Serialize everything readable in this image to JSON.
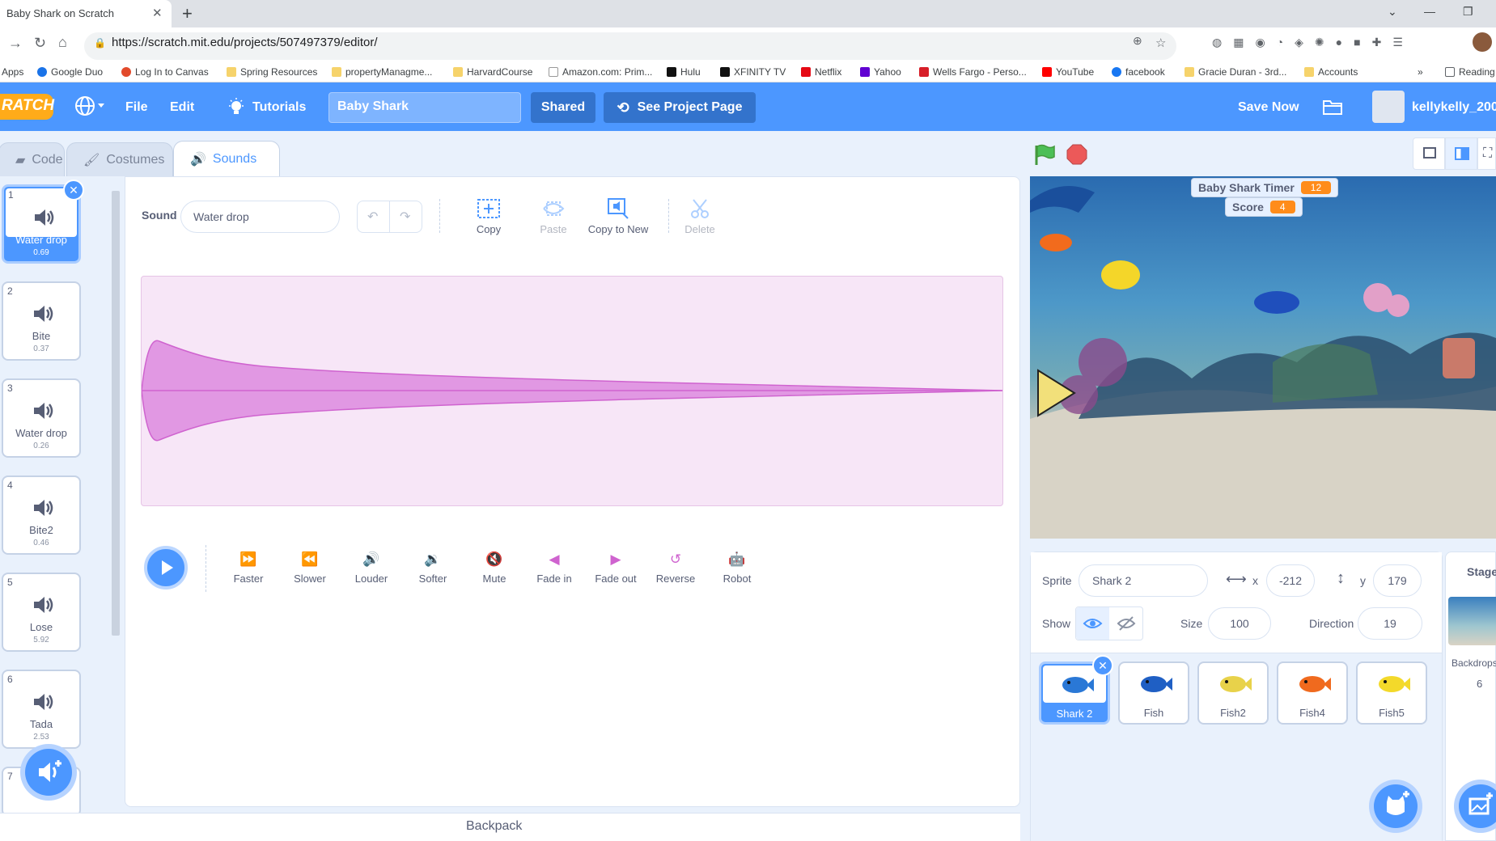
{
  "browser": {
    "tab_title": "Baby Shark on Scratch",
    "url": "https://scratch.mit.edu/projects/507497379/editor/",
    "bookmarks": [
      "Apps",
      "Google Duo",
      "Log In to Canvas",
      "Spring Resources",
      "propertyManagme...",
      "HarvardCourse",
      "Amazon.com: Prim...",
      "Hulu",
      "XFINITY TV",
      "Netflix",
      "Yahoo",
      "Wells Fargo - Perso...",
      "YouTube",
      "facebook",
      "Gracie Duran - 3rd...",
      "Accounts",
      "Reading"
    ]
  },
  "menubar": {
    "file": "File",
    "edit": "Edit",
    "tutorials": "Tutorials",
    "project_title": "Baby Shark",
    "shared": "Shared",
    "see_project": "See Project Page",
    "save_now": "Save Now",
    "username": "kellykelly_2003"
  },
  "tabs": {
    "code": "Code",
    "costumes": "Costumes",
    "sounds": "Sounds"
  },
  "sounds": [
    {
      "num": "1",
      "name": "Water drop",
      "duration": "0.69"
    },
    {
      "num": "2",
      "name": "Bite",
      "duration": "0.37"
    },
    {
      "num": "3",
      "name": "Water drop",
      "duration": "0.26"
    },
    {
      "num": "4",
      "name": "Bite2",
      "duration": "0.46"
    },
    {
      "num": "5",
      "name": "Lose",
      "duration": "5.92"
    },
    {
      "num": "6",
      "name": "Tada",
      "duration": "2.53"
    },
    {
      "num": "7",
      "name": "",
      "duration": ""
    }
  ],
  "sound_editor": {
    "label": "Sound",
    "name": "Water drop",
    "tools": {
      "copy": "Copy",
      "paste": "Paste",
      "copy_to_new": "Copy to New",
      "delete": "Delete"
    },
    "effects": [
      "Faster",
      "Slower",
      "Louder",
      "Softer",
      "Mute",
      "Fade in",
      "Fade out",
      "Reverse",
      "Robot"
    ],
    "wave_color": "#cf63cf"
  },
  "backpack": "Backpack",
  "stage": {
    "monitors": [
      {
        "label": "Baby Shark Timer",
        "value": "12"
      },
      {
        "label": "Score",
        "value": "4"
      }
    ]
  },
  "sprite_info": {
    "sprite_label": "Sprite",
    "sprite_name": "Shark 2",
    "x_label": "x",
    "x": "-212",
    "y_label": "y",
    "y": "179",
    "show_label": "Show",
    "size_label": "Size",
    "size": "100",
    "direction_label": "Direction",
    "direction": "19"
  },
  "sprites": [
    {
      "name": "Shark 2",
      "color": "#2a78d6"
    },
    {
      "name": "Fish",
      "color": "#1f5fc4"
    },
    {
      "name": "Fish2",
      "color": "#e8d24a"
    },
    {
      "name": "Fish4",
      "color": "#f06a1e"
    },
    {
      "name": "Fish5",
      "color": "#f3d92a"
    }
  ],
  "stage_pane": {
    "label": "Stage",
    "backdrops_label": "Backdrops",
    "backdrops_count": "6"
  },
  "colors": {
    "accent": "#4c97ff",
    "orange": "#ff8c1a",
    "sound_pink": "#cf63cf"
  }
}
